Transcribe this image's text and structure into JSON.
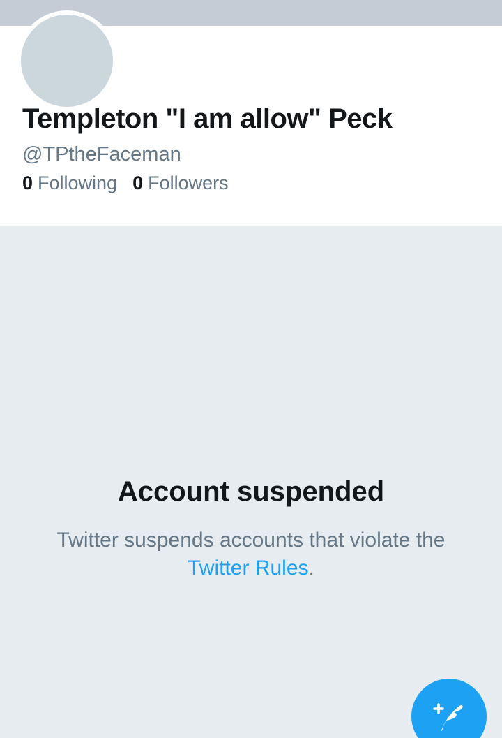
{
  "profile": {
    "display_name": "Templeton \"I am allow\" Peck",
    "handle": "@TPtheFaceman",
    "following_count": "0",
    "following_label": "Following",
    "followers_count": "0",
    "followers_label": "Followers"
  },
  "suspension": {
    "title": "Account suspended",
    "message_before_link": "Twitter suspends accounts that violate the ",
    "link_text": "Twitter Rules",
    "message_after_link": "."
  },
  "fab": {
    "icon": "compose-tweet-icon"
  },
  "colors": {
    "accent": "#1da1f2",
    "background": "#e6ecf0",
    "banner": "#c5ccd5",
    "avatar_placeholder": "#ccd6dd",
    "primary_text": "#14171a",
    "secondary_text": "#657786"
  }
}
